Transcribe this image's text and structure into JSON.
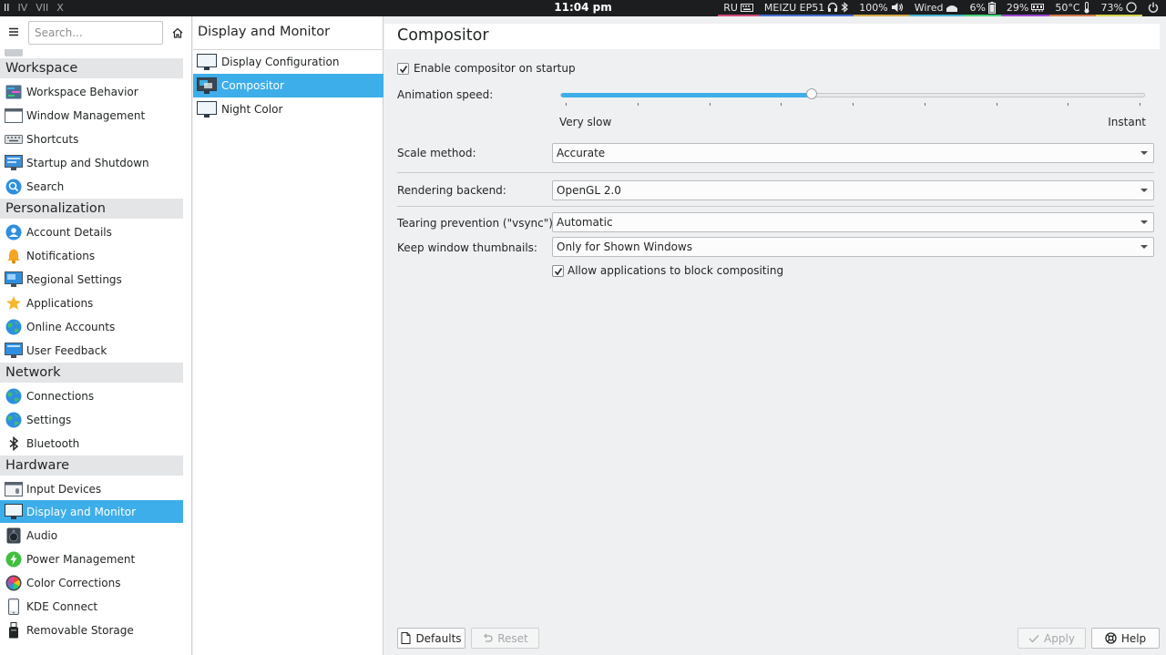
{
  "colors": {
    "accent": "#3daee9",
    "panel": "#1b1d1f",
    "category_bg": "#e3e5e7"
  },
  "topbar": {
    "workspaces": [
      "II",
      "IV",
      "VII",
      "X"
    ],
    "clock": "11:04 pm",
    "tray": [
      {
        "label": "RU",
        "icon": "keyboard-icon"
      },
      {
        "label": "MEIZU EP51",
        "icon": "headphones-icon"
      },
      {
        "label": "100%",
        "icon": "volume-icon"
      },
      {
        "label": "Wired",
        "icon": "network-icon"
      },
      {
        "label": "6%",
        "icon": "battery-icon"
      },
      {
        "label": "29%",
        "icon": "memory-icon"
      },
      {
        "label": "50°C",
        "icon": "thermometer-icon"
      },
      {
        "label": "73%",
        "icon": "cpu-icon"
      }
    ]
  },
  "sidebar": {
    "search_placeholder": "Search...",
    "categories": {
      "workspace": "Workspace",
      "personalization": "Personalization",
      "network": "Network",
      "hardware": "Hardware"
    },
    "items": {
      "workspace_behavior": "Workspace Behavior",
      "window_management": "Window Management",
      "shortcuts": "Shortcuts",
      "startup_shutdown": "Startup and Shutdown",
      "search": "Search",
      "account_details": "Account Details",
      "notifications": "Notifications",
      "regional_settings": "Regional Settings",
      "applications": "Applications",
      "online_accounts": "Online Accounts",
      "user_feedback": "User Feedback",
      "connections": "Connections",
      "settings": "Settings",
      "bluetooth": "Bluetooth",
      "input_devices": "Input Devices",
      "display_monitor": "Display and Monitor",
      "audio": "Audio",
      "power_management": "Power Management",
      "color_corrections": "Color Corrections",
      "kde_connect": "KDE Connect",
      "removable_storage": "Removable Storage"
    }
  },
  "middle": {
    "title": "Display and Monitor",
    "items": [
      "Display Configuration",
      "Compositor",
      "Night Color"
    ]
  },
  "main": {
    "title": "Compositor",
    "enable_on_startup": {
      "label": "Enable compositor on startup",
      "checked": true
    },
    "animation_speed": {
      "label": "Animation speed:",
      "min_label": "Very slow",
      "max_label": "Instant",
      "value_fraction": 0.43
    },
    "scale_method": {
      "label": "Scale method:",
      "value": "Accurate"
    },
    "rendering_backend": {
      "label": "Rendering backend:",
      "value": "OpenGL 2.0"
    },
    "tearing_prevention": {
      "label": "Tearing prevention (\"vsync\"):",
      "value": "Automatic"
    },
    "keep_thumbnails": {
      "label": "Keep window thumbnails:",
      "value": "Only for Shown Windows"
    },
    "allow_block": {
      "label": "Allow applications to block compositing",
      "checked": true
    }
  },
  "buttons": {
    "defaults": "Defaults",
    "reset": "Reset",
    "apply": "Apply",
    "help": "Help"
  }
}
